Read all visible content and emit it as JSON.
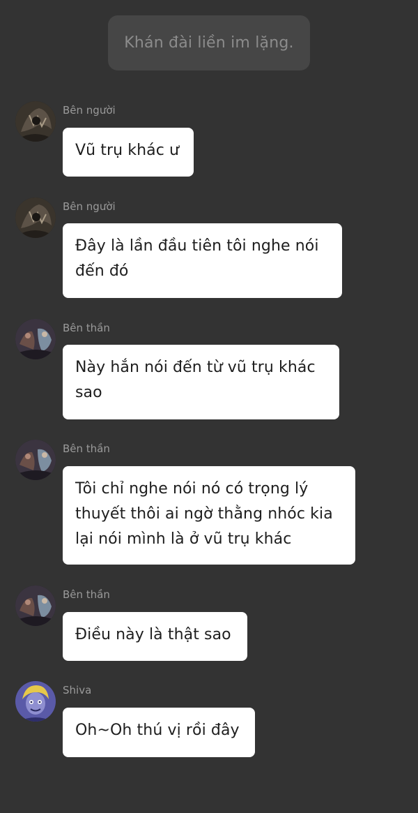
{
  "narration": "Khán đài liền im lặng.",
  "messages": [
    {
      "sender": "Bên người",
      "text": "Vũ trụ khác ư",
      "avatar_icon": "dark-warrior-avatar-icon"
    },
    {
      "sender": "Bên người",
      "text": "Đây là lần đầu tiên tôi nghe nói đến đó",
      "avatar_icon": "dark-warrior-avatar-icon"
    },
    {
      "sender": "Bên thần",
      "text": "Này hắn nói đến từ vũ trụ khác sao",
      "avatar_icon": "god-group-avatar-icon"
    },
    {
      "sender": "Bên thần",
      "text": "Tôi chỉ nghe nói nó có trọng lý thuyết thôi ai ngờ thằng nhóc kia lại nói mình là ở vũ trụ khác",
      "avatar_icon": "god-group-avatar-icon"
    },
    {
      "sender": "Bên thần",
      "text": "Điều này là thật sao",
      "avatar_icon": "god-group-avatar-icon"
    },
    {
      "sender": "Shiva",
      "text": "Oh~Oh thú vị rồi đây",
      "avatar_icon": "shiva-avatar-icon"
    }
  ],
  "colors": {
    "background": "#333333",
    "narration_bg": "#464646",
    "narration_text": "#8c8c8c",
    "bubble_bg": "#ffffff",
    "sender_text": "#9a9a9a"
  }
}
